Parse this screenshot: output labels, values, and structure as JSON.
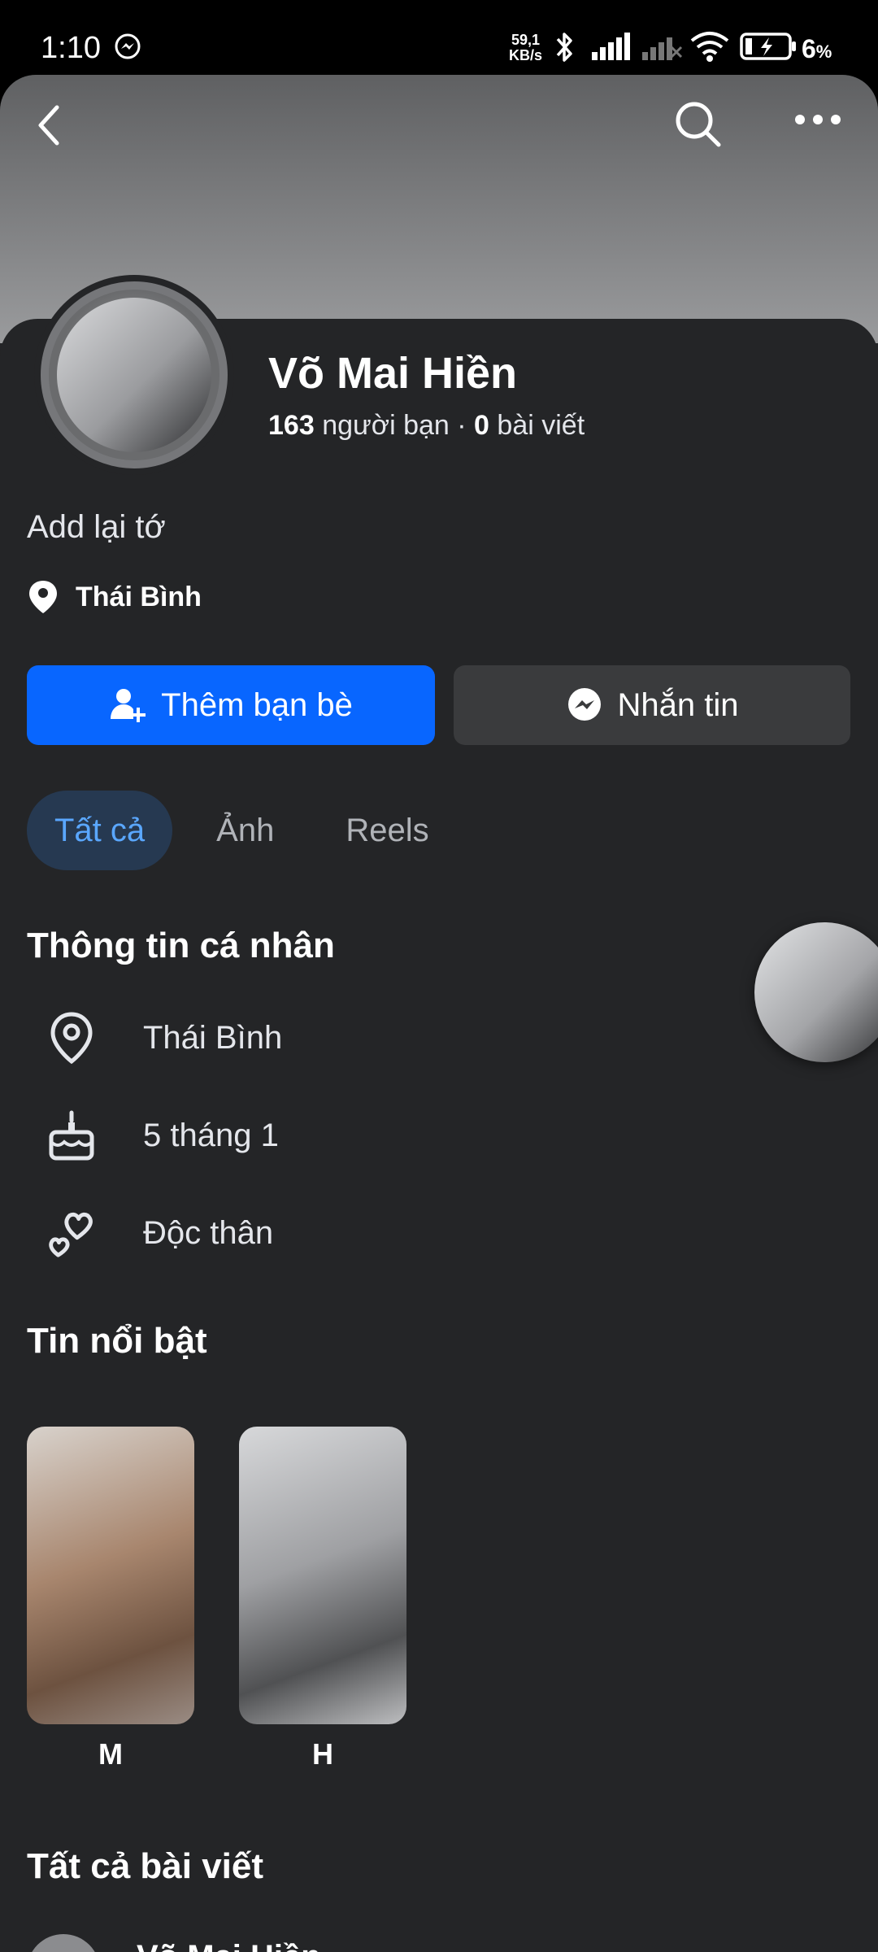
{
  "status_bar": {
    "time": "1:10",
    "net_speed_value": "59,1",
    "net_speed_unit": "KB/s",
    "battery_percent": "6",
    "battery_percent_sign": "%"
  },
  "profile": {
    "name": "Võ Mai Hiền",
    "friends_count": "163",
    "friends_label": "người bạn",
    "separator": "·",
    "posts_count": "0",
    "posts_label": "bài viết",
    "bio": "Add lại tớ",
    "location": "Thái Bình"
  },
  "actions": {
    "add_friend_label": "Thêm bạn bè",
    "message_label": "Nhắn tin"
  },
  "tabs": [
    {
      "label": "Tất cả",
      "active": true
    },
    {
      "label": "Ảnh",
      "active": false
    },
    {
      "label": "Reels",
      "active": false
    }
  ],
  "personal_info": {
    "title": "Thông tin cá nhân",
    "items": [
      {
        "icon": "location-pin-icon",
        "text": "Thái Bình"
      },
      {
        "icon": "birthday-cake-icon",
        "text": "5 tháng 1"
      },
      {
        "icon": "relationship-hearts-icon",
        "text": "Độc thân"
      }
    ]
  },
  "highlights": {
    "title": "Tin nổi bật",
    "items": [
      {
        "label": "M"
      },
      {
        "label": "H"
      }
    ]
  },
  "posts": {
    "title": "Tất cả bài viết",
    "author_name": "Võ Mai Hiền"
  },
  "colors": {
    "background": "#242527",
    "primary_button": "#0866ff",
    "secondary_button": "#3a3b3d",
    "active_tab_bg": "#263951",
    "active_tab_text": "#5aa7ff"
  }
}
